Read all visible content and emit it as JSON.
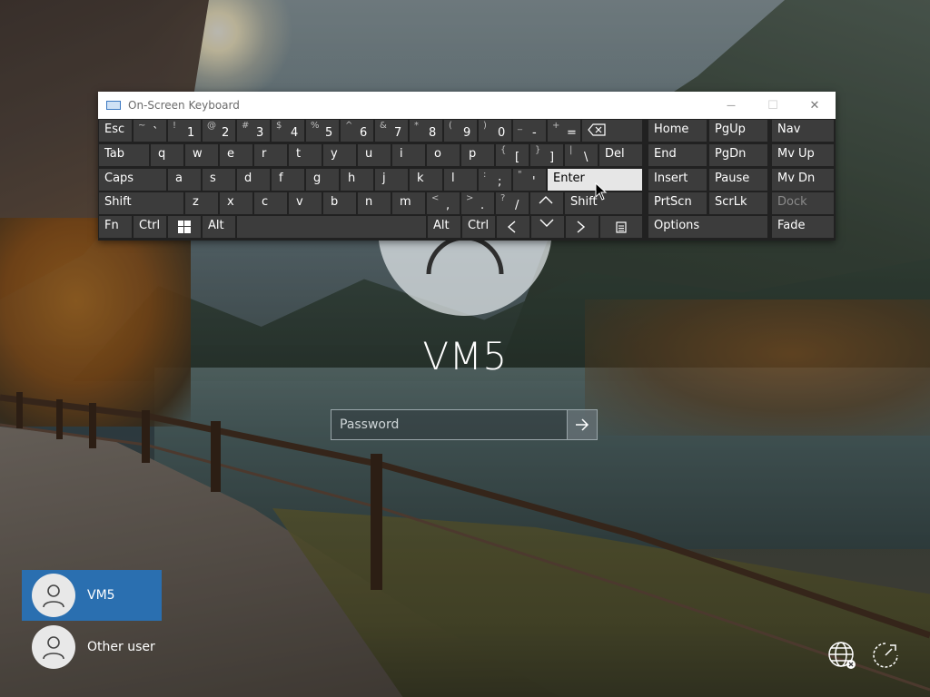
{
  "lock_screen": {
    "username": "VM5",
    "password_placeholder": "Password"
  },
  "users": [
    {
      "name": "VM5",
      "selected": true
    },
    {
      "name": "Other user",
      "selected": false
    }
  ],
  "osk": {
    "title": "On-Screen Keyboard",
    "controls": {
      "minimize": "—",
      "maximize": "☐",
      "close": "✕"
    },
    "keys": {
      "esc": "Esc",
      "tilde": {
        "shift": "~",
        "main": "`"
      },
      "d1": {
        "shift": "!",
        "main": "1"
      },
      "d2": {
        "shift": "@",
        "main": "2"
      },
      "d3": {
        "shift": "#",
        "main": "3"
      },
      "d4": {
        "shift": "$",
        "main": "4"
      },
      "d5": {
        "shift": "%",
        "main": "5"
      },
      "d6": {
        "shift": "^",
        "main": "6"
      },
      "d7": {
        "shift": "&",
        "main": "7"
      },
      "d8": {
        "shift": "*",
        "main": "8"
      },
      "d9": {
        "shift": "(",
        "main": "9"
      },
      "d0": {
        "shift": ")",
        "main": "0"
      },
      "minus": {
        "shift": "_",
        "main": "-"
      },
      "equals": {
        "shift": "+",
        "main": "="
      },
      "tab": "Tab",
      "q": "q",
      "w": "w",
      "e": "e",
      "r": "r",
      "t": "t",
      "y": "y",
      "u": "u",
      "i": "i",
      "o": "o",
      "p": "p",
      "lbracket": {
        "shift": "{",
        "main": "["
      },
      "rbracket": {
        "shift": "}",
        "main": "]"
      },
      "backslash": {
        "shift": "|",
        "main": "\\"
      },
      "del": "Del",
      "caps": "Caps",
      "a": "a",
      "s": "s",
      "d": "d",
      "f": "f",
      "g": "g",
      "h": "h",
      "j": "j",
      "k": "k",
      "l": "l",
      "semicolon": {
        "shift": ":",
        "main": ";"
      },
      "quote": {
        "shift": "\"",
        "main": "'"
      },
      "enter": "Enter",
      "shift_l": "Shift",
      "z": "z",
      "x": "x",
      "c": "c",
      "v": "v",
      "b": "b",
      "n": "n",
      "m": "m",
      "comma": {
        "shift": "<",
        "main": ","
      },
      "period": {
        "shift": ">",
        "main": "."
      },
      "slash": {
        "shift": "?",
        "main": "/"
      },
      "shift_r": "Shift",
      "fn": "Fn",
      "ctrl_l": "Ctrl",
      "alt_l": "Alt",
      "alt_r": "Alt",
      "ctrl_r": "Ctrl",
      "home": "Home",
      "pgup": "PgUp",
      "nav": "Nav",
      "end": "End",
      "pgdn": "PgDn",
      "mvup": "Mv Up",
      "insert": "Insert",
      "pause": "Pause",
      "mvdn": "Mv Dn",
      "prtscn": "PrtScn",
      "scrlk": "ScrLk",
      "dock": "Dock",
      "options": "Options",
      "fade": "Fade"
    }
  },
  "colors": {
    "selected_user": "#2a6fb0",
    "key_bg": "#3c3c3c",
    "key_hover": "#e6e6e6",
    "osk_bg": "#212121"
  },
  "icons": {
    "backspace": "backspace-icon",
    "windows": "windows-logo-icon",
    "menu": "context-menu-icon",
    "network": "network-icon",
    "accessibility": "ease-of-access-icon",
    "power": "power-icon",
    "submit": "arrow-right-icon"
  }
}
